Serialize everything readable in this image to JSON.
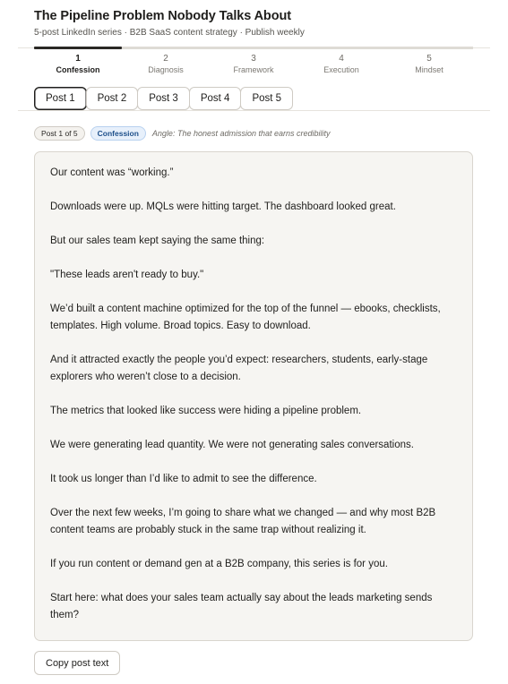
{
  "header": {
    "title": "The Pipeline Problem Nobody Talks About",
    "subtitle": "5-post LinkedIn series · B2B SaaS content strategy · Publish weekly"
  },
  "stepper": {
    "active_index": 0,
    "steps": [
      {
        "num": "1",
        "label": "Confession"
      },
      {
        "num": "2",
        "label": "Diagnosis"
      },
      {
        "num": "3",
        "label": "Framework"
      },
      {
        "num": "4",
        "label": "Execution"
      },
      {
        "num": "5",
        "label": "Mindset"
      }
    ]
  },
  "tabs": {
    "active_index": 0,
    "items": [
      "Post 1",
      "Post 2",
      "Post 3",
      "Post 4",
      "Post 5"
    ]
  },
  "post": {
    "counter_label": "Post 1 of 5",
    "stage_label": "Confession",
    "angle": "Angle: The honest admission that earns credibility",
    "paragraphs": [
      "Our content was “working.”",
      "Downloads were up. MQLs were hitting target. The dashboard looked great.",
      "But our sales team kept saying the same thing:",
      "\"These leads aren't ready to buy.\"",
      "We’d built a content machine optimized for the top of the funnel — ebooks, checklists, templates. High volume. Broad topics. Easy to download.",
      "And it attracted exactly the people you’d expect: researchers, students, early-stage explorers who weren’t close to a decision.",
      "The metrics that looked like success were hiding a pipeline problem.",
      "We were generating lead quantity. We were not generating sales conversations.",
      "It took us longer than I’d like to admit to see the difference.",
      "Over the next few weeks, I’m going to share what we changed — and why most B2B content teams are probably stuck in the same trap without realizing it.",
      "If you run content or demand gen at a B2B company, this series is for you.",
      "Start here: what does your sales team actually say about the leads marketing sends them?"
    ]
  },
  "actions": {
    "copy_label": "Copy post text"
  },
  "colors": {
    "active_chip_bg": "#e7f0fb",
    "active_chip_text": "#1d4f8a",
    "post_bg": "#f6f5f2",
    "active_indicator": "#2a2825"
  }
}
